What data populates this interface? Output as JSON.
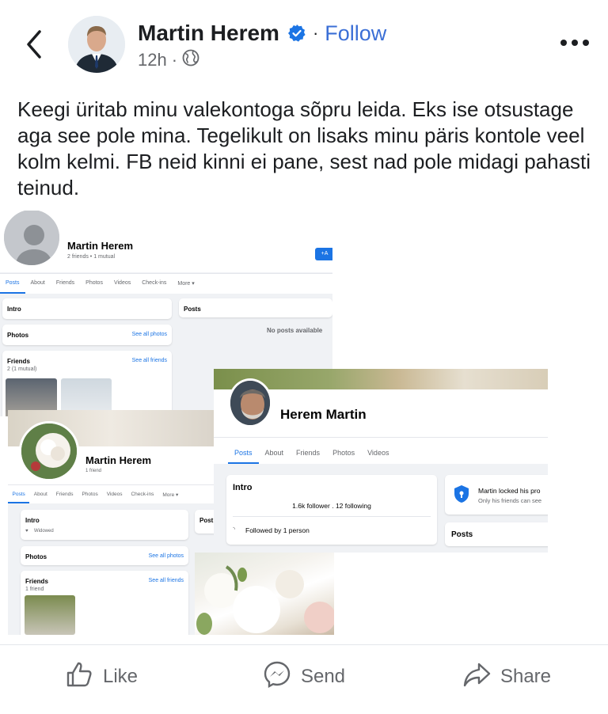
{
  "header": {
    "back_icon": "chevron-left-icon",
    "author_name": "Martin Herem",
    "verified_icon": "verified-badge-icon",
    "separator": "·",
    "follow_label": "Follow",
    "time": "12h",
    "privacy_icon": "globe-icon",
    "more_icon": "more-horizontal-icon",
    "colors": {
      "follow": "#3b6fd6",
      "verified": "#1b74e4"
    }
  },
  "post": {
    "text": "Keegi üritab minu valekontoga sõpru leida. Eks ise otsustage aga see pole mina. Tegelikult on lisaks minu päris kontole veel kolm kelmi. FB neid kinni ei pane, sest nad pole midagi pahasti teinud."
  },
  "collage": {
    "shot1": {
      "name": "Martin Herem",
      "sub": "2 friends • 1 mutual",
      "nav": [
        "Posts",
        "About",
        "Friends",
        "Photos",
        "Videos",
        "Check-ins",
        "More ▾"
      ],
      "intro": "Intro",
      "photos": "Photos",
      "see_all_photos": "See all photos",
      "friends": "Friends",
      "friends_sub": "2 (1 mutual)",
      "see_all_friends": "See all friends",
      "posts": "Posts",
      "no_posts": "No posts available"
    },
    "shot2": {
      "name": "Martin Herem",
      "sub": "1 friend",
      "nav": [
        "Posts",
        "About",
        "Friends",
        "Photos",
        "Videos",
        "Check-ins",
        "More ▾"
      ],
      "intro": "Intro",
      "widowed": "Widowed",
      "photos": "Photos",
      "see_all_photos": "See all photos",
      "friends": "Friends",
      "friends_sub": "1 friend",
      "see_all_friends": "See all friends",
      "posts": "Post"
    },
    "shot3": {
      "name": "Herem Martin",
      "nav": [
        "Posts",
        "About",
        "Friends",
        "Photos",
        "Videos"
      ],
      "intro": "Intro",
      "followers": "1.6k follower . 12 following",
      "followed_by": "Followed by 1 person",
      "locked_title": "Martin locked his pro",
      "locked_sub": "Only his friends can see",
      "posts": "Posts"
    }
  },
  "actions": [
    {
      "label": "Like",
      "icon": "thumbs-up-icon"
    },
    {
      "label": "Send",
      "icon": "messenger-icon"
    },
    {
      "label": "Share",
      "icon": "share-arrow-icon"
    }
  ]
}
